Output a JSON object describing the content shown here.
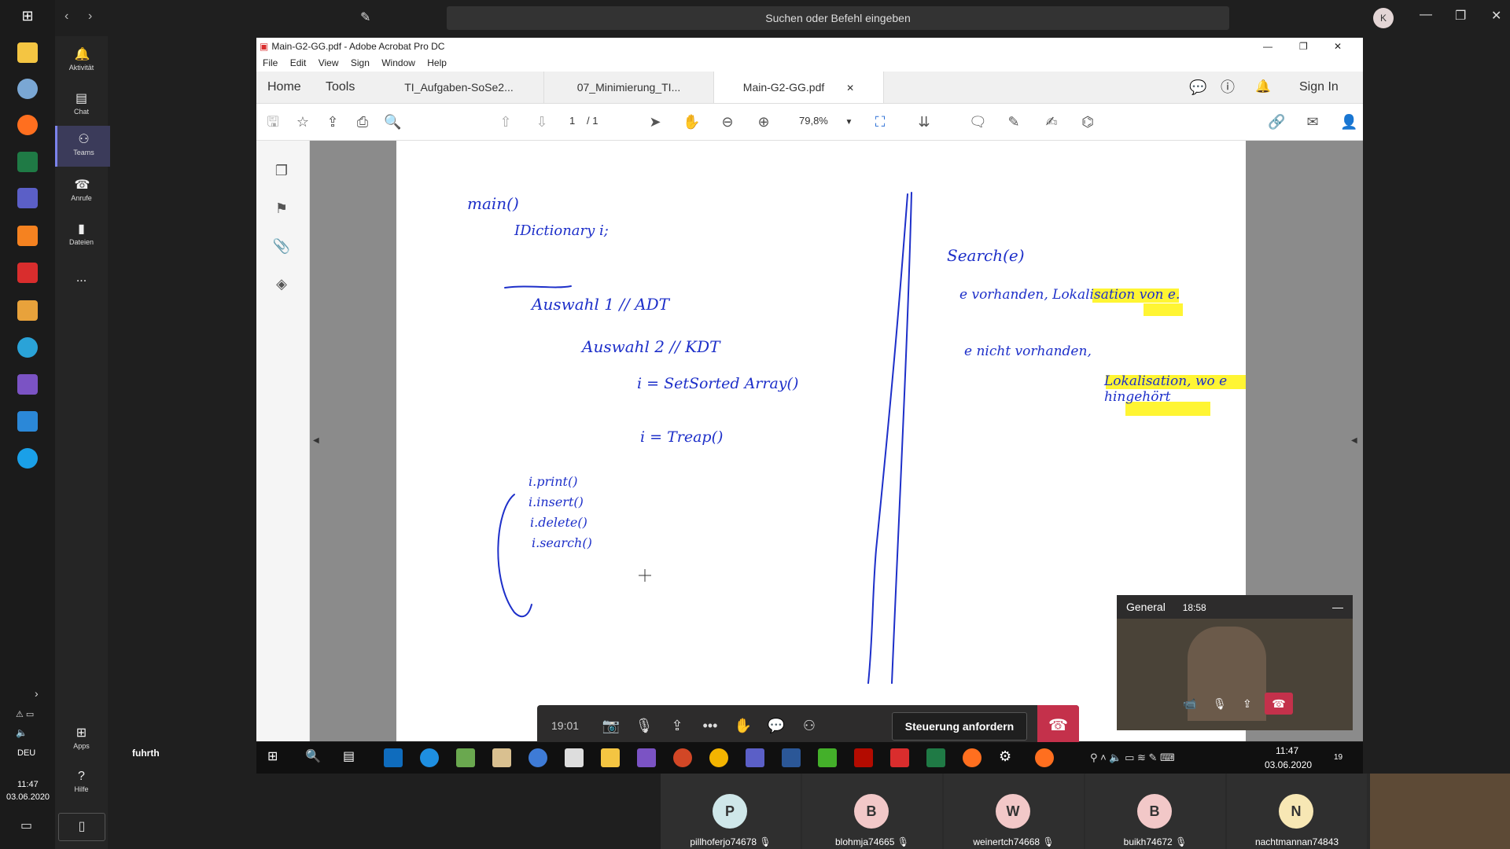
{
  "topbar": {
    "search_placeholder": "Suchen oder Befehl eingeben",
    "avatar_initial": "K"
  },
  "rail": [
    {
      "label": "Aktivität",
      "icon": "bell-icon"
    },
    {
      "label": "Chat",
      "icon": "chat-icon"
    },
    {
      "label": "Teams",
      "icon": "teams-icon",
      "active": true
    },
    {
      "label": "Anrufe",
      "icon": "phone-icon"
    },
    {
      "label": "Dateien",
      "icon": "file-icon"
    },
    {
      "label": "...",
      "icon": "more-icon"
    }
  ],
  "rail_bottom": {
    "apps": "Apps",
    "help": "Hilfe"
  },
  "system": {
    "lang": "DEU",
    "time": "11:47",
    "date": "03.06.2020"
  },
  "presenter": "fuhrth",
  "acrobat": {
    "title": "Main-G2-GG.pdf - Adobe Acrobat Pro DC",
    "menu": [
      "File",
      "Edit",
      "View",
      "Sign",
      "Window",
      "Help"
    ],
    "home": "Home",
    "tools": "Tools",
    "tabs": [
      "TI_Aufgaben-SoSe2...",
      "07_Minimierung_TI...",
      "Main-G2-GG.pdf"
    ],
    "sign_in": "Sign In",
    "page_current": "1",
    "page_total": "/ 1",
    "zoom": "79,8%"
  },
  "note": {
    "left": [
      "main()",
      "IDictionary i;",
      "Auswahl 1 // ADT",
      "Auswahl 2 // KDT",
      "i = SetSorted Array()",
      "i = Treap()",
      "i.print()",
      "i.insert()",
      "i.delete()",
      "i.search()"
    ],
    "right": [
      "Search(e)",
      "e vorhanden, Lokalisation von e.",
      "e nicht vorhanden,",
      "Lokalisation, wo e hingehört"
    ]
  },
  "meeting": {
    "timer": "19:01",
    "control_button": "Steuerung anfordern"
  },
  "video": {
    "channel": "General",
    "time": "18:58"
  },
  "win_taskbar": {
    "time": "11:47",
    "date": "03.06.2020",
    "notifications": "19"
  },
  "participants": [
    {
      "initial": "P",
      "name": "pillhoferjo74678",
      "color": "#cfe7e9"
    },
    {
      "initial": "B",
      "name": "blohmja74665",
      "color": "#f2c8c8"
    },
    {
      "initial": "W",
      "name": "weinertch74668",
      "color": "#f2c8c8"
    },
    {
      "initial": "B",
      "name": "buikh74672",
      "color": "#f2c8c8"
    },
    {
      "initial": "N",
      "name": "nachtmannan74843",
      "color": "#f7e7b4"
    }
  ]
}
